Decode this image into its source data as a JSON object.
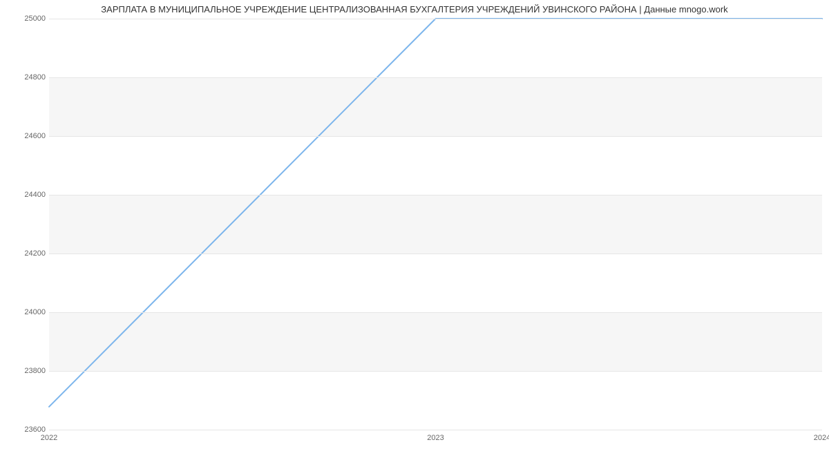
{
  "chart_data": {
    "type": "line",
    "title": "ЗАРПЛАТА В МУНИЦИПАЛЬНОЕ УЧРЕЖДЕНИЕ ЦЕНТРАЛИЗОВАННАЯ БУХГАЛТЕРИЯ УЧРЕЖДЕНИЙ УВИНСКОГО РАЙОНА | Данные mnogo.work",
    "x": [
      2022,
      2023,
      2024
    ],
    "values": [
      23678,
      25000,
      25000
    ],
    "ylim": [
      23600,
      25000
    ],
    "xlim": [
      2022,
      2024
    ],
    "y_ticks": [
      23600,
      23800,
      24000,
      24200,
      24400,
      24600,
      24800,
      25000
    ],
    "x_ticks": [
      2022,
      2023,
      2024
    ],
    "xlabel": "",
    "ylabel": "",
    "line_color": "#7cb5ec"
  }
}
